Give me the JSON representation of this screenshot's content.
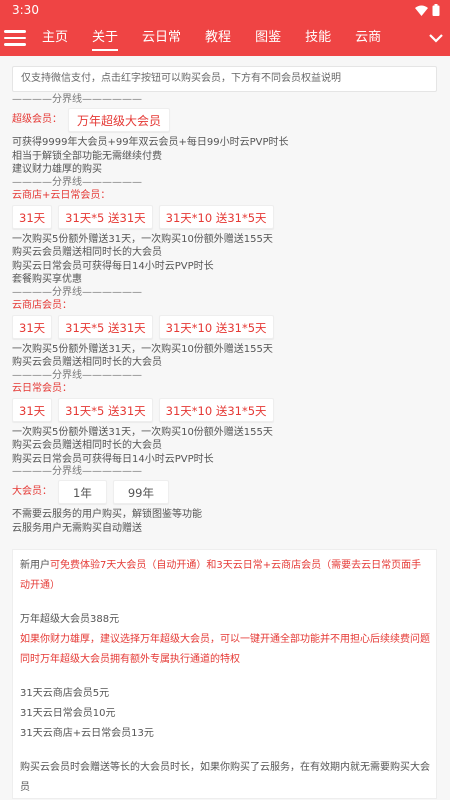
{
  "status": {
    "time": "3:30"
  },
  "tabs": [
    "主页",
    "关于",
    "云日常",
    "教程",
    "图鉴",
    "技能",
    "云商"
  ],
  "active_tab": 1,
  "notice": "仅支持微信支付，点击红字按钮可以购买会员，下方有不同会员权益说明",
  "divider": "————分界线——————",
  "super": {
    "label": "超级会员：",
    "button": "万年超级大会员",
    "lines": [
      "可获得9999年大会员+99年双云会员+每日99小时云PVP时长",
      "相当于解锁全部功能无需继续付费",
      "建议财力雄厚的购买"
    ]
  },
  "combo": {
    "label": "云商店+云日常会员：",
    "buttons": [
      "31天",
      "31天*5 送31天",
      "31天*10 送31*5天"
    ],
    "lines": [
      "一次购买5份额外赠送31天，一次购买10份额外赠送155天",
      "购买云会员赠送相同时长的大会员",
      "购买云日常会员可获得每日14小时云PVP时长",
      "套餐购买享优惠"
    ]
  },
  "shop": {
    "label": "云商店会员：",
    "buttons": [
      "31天",
      "31天*5 送31天",
      "31天*10 送31*5天"
    ],
    "lines": [
      "一次购买5份额外赠送31天，一次购买10份额外赠送155天",
      "购买云会员赠送相同时长的大会员"
    ]
  },
  "daily": {
    "label": "云日常会员：",
    "buttons": [
      "31天",
      "31天*5 送31天",
      "31天*10 送31*5天"
    ],
    "lines": [
      "一次购买5份额外赠送31天，一次购买10份额外赠送155天",
      "购买云会员赠送相同时长的大会员",
      "购买云日常会员可获得每日14小时云PVP时长"
    ]
  },
  "big": {
    "label": "大会员：",
    "buttons": [
      "1年",
      "99年"
    ],
    "lines": [
      "不需要云服务的用户购买，解锁图鉴等功能",
      "云服务用户无需购买自动赠送"
    ]
  },
  "card": {
    "intro_a": "新用户",
    "intro_b": "可免费体验7天大会员（自动开通）和3天云日常+云商店会员（需要去云日常页面手动开通）",
    "price_super": "万年超级大会员388元",
    "advice": "如果你财力雄厚，建议选择万年超级大会员，可以一键开通全部功能并不用担心后续续费问题同时万年超级大会员拥有额外专属执行通道的特权",
    "price_shop": "31天云商店会员5元",
    "price_daily": "31天云日常会员10元",
    "price_combo": "31天云商店+云日常会员13元",
    "tail": "购买云会员时会赠送等长的大会员时长，如果你购买了云服务，在有效期内就无需要购买大会员"
  }
}
